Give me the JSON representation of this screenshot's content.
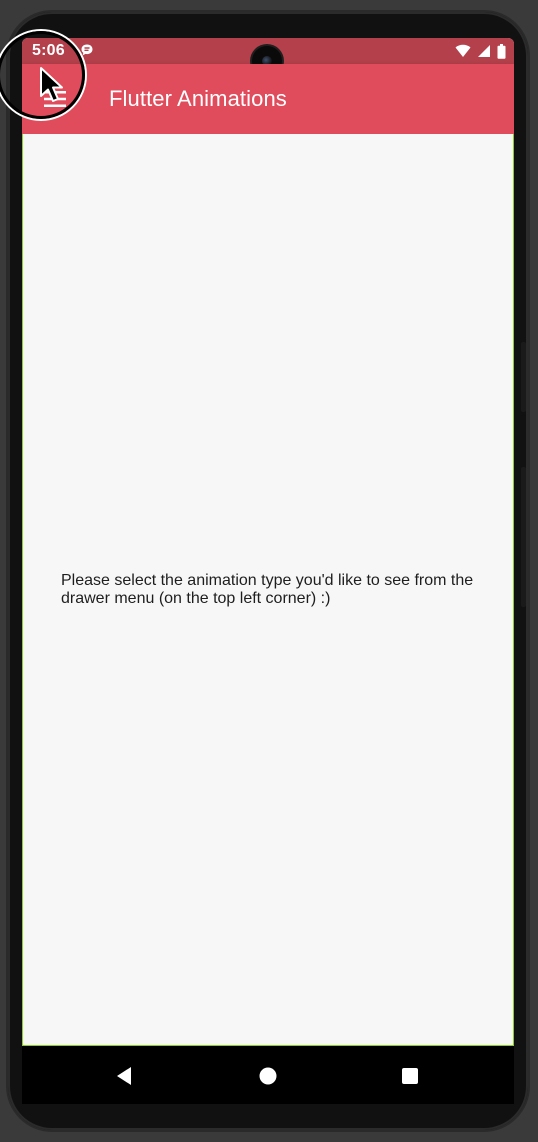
{
  "status_bar": {
    "time": "5:06",
    "left_icon": "notification-bubble-icon",
    "right_icons": [
      "wifi-icon",
      "cellular-signal-icon",
      "battery-icon"
    ]
  },
  "app_bar": {
    "menu_icon": "hamburger-menu-icon",
    "title": "Flutter Animations",
    "background_color": "#e04c5b"
  },
  "body": {
    "message": "Please select the animation type you'd like to see from the drawer menu (on the top left corner) :)"
  },
  "navigation_bar": {
    "buttons": [
      "back-icon",
      "home-icon",
      "recents-icon"
    ]
  },
  "colors": {
    "status_bar": "#b3404b",
    "app_bar": "#e04c5b",
    "content_background": "#f7f7f7",
    "screen_border": "#8ccd2e"
  }
}
